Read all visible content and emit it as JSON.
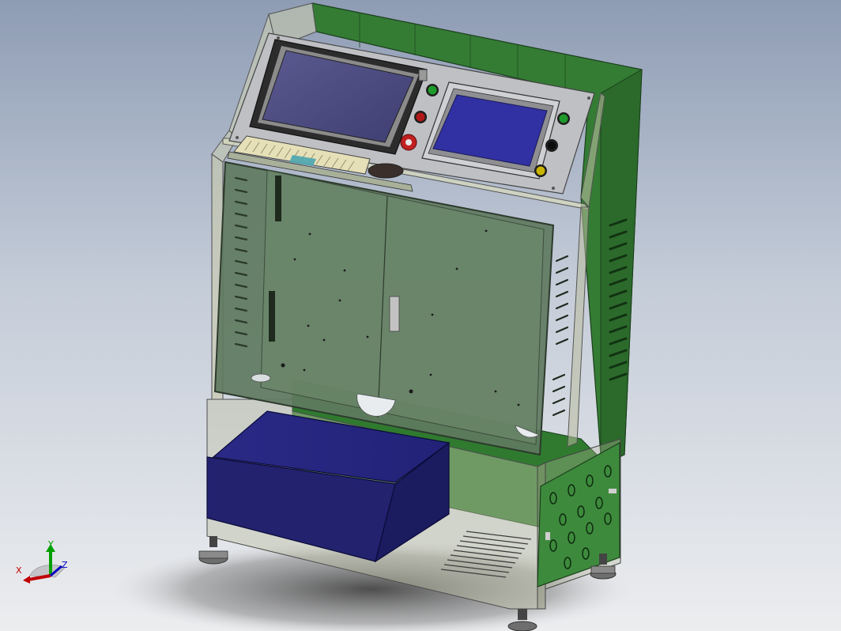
{
  "viewport": {
    "background_top": "#8e9cb4",
    "background_bottom": "#ecedef"
  },
  "colors": {
    "enclosure_green": "#2f7a2f",
    "glass_tint": "#b8c6a0",
    "screen_blue": "#3a3aa8",
    "screen_large": "#4a4a7e",
    "battery_navy": "#1d1d6e",
    "button_green": "#1e9a2a",
    "button_red": "#b01818",
    "button_yellow": "#c8b400",
    "button_black": "#1a1a1a"
  },
  "parts": {
    "main_display": "main-display-monitor",
    "hmi_touchscreen": "hmi-touchscreen",
    "keyboard": "keyboard-tray",
    "battery_box": "battery-box",
    "mounting_plate": "component-mounting-plate",
    "side_terminal_panel": "side-connector-panel",
    "leveling_feet": "leveling-feet"
  },
  "triad": {
    "x_label": "X",
    "y_label": "Y",
    "z_label": "Z",
    "x_color": "#c00000",
    "y_color": "#00a000",
    "z_color": "#0000c0"
  }
}
